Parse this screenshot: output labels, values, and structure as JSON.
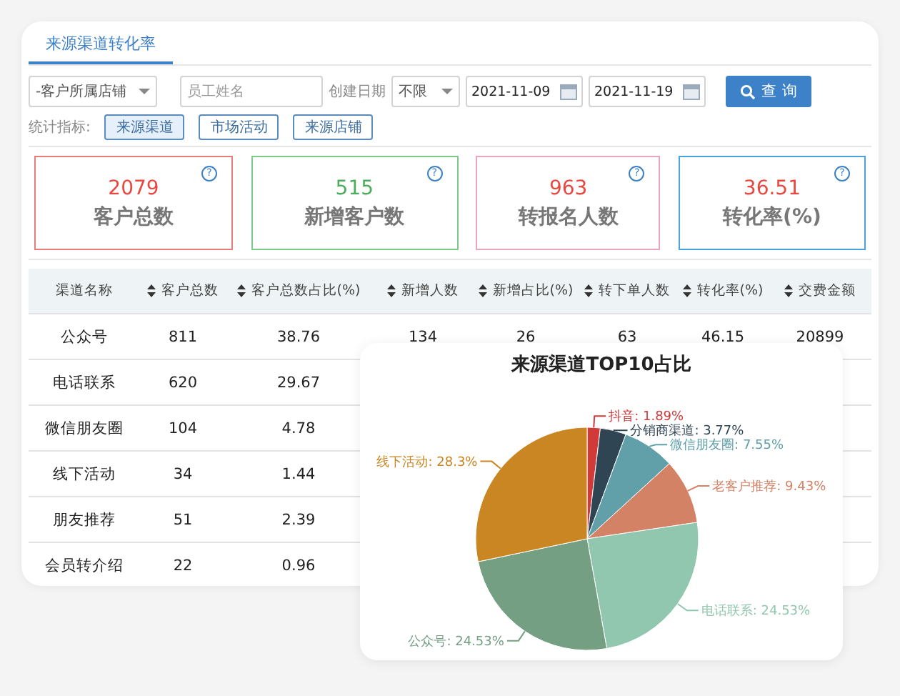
{
  "tabs": [
    {
      "label": "来源渠道转化率",
      "selected": true
    }
  ],
  "filters": {
    "store_select": "-客户所属店铺",
    "employee": {
      "placeholder": "员工姓名"
    },
    "date_label": "创建日期",
    "date_range_select": "不限",
    "start_date": "2021-11-09",
    "end_date": "2021-11-19",
    "query_button": "查 询"
  },
  "indicators": {
    "label": "统计指标:",
    "options": [
      {
        "label": "来源渠道",
        "selected": true
      },
      {
        "label": "市场活动",
        "selected": false
      },
      {
        "label": "来源店铺",
        "selected": false
      }
    ]
  },
  "stats": [
    {
      "value": {
        "text": "2079",
        "color": "#e8483f"
      },
      "label": "客户总数",
      "help": "?",
      "color": "#e87c7c"
    },
    {
      "value": {
        "text": "515",
        "color": "#4cae5c"
      },
      "label": "新增客户数",
      "help": "?",
      "color": "#7cc98a"
    },
    {
      "value": {
        "text": "963",
        "color": "#e8483f"
      },
      "label": "转报名人数",
      "help": "?",
      "color": "#e8a6bb"
    },
    {
      "value": {
        "text": "36.51",
        "color": "#e8483f"
      },
      "label": "转化率(%)",
      "help": "?",
      "color": "#4aa3df"
    }
  ],
  "table": {
    "columns": [
      {
        "label": "渠道名称",
        "sortable": false
      },
      {
        "label": "客户总数",
        "sortable": true
      },
      {
        "label": "客户总数占比(%)",
        "sortable": true
      },
      {
        "label": "新增人数",
        "sortable": true
      },
      {
        "label": "新增占比(%)",
        "sortable": true
      },
      {
        "label": "转下单人数",
        "sortable": true
      },
      {
        "label": "转化率(%)",
        "sortable": true
      },
      {
        "label": "交费金额",
        "sortable": true
      }
    ],
    "rows": [
      [
        "公众号",
        "811",
        "38.76",
        "134",
        "26",
        "63",
        "46.15",
        "20899"
      ],
      [
        "电话联系",
        "620",
        "29.67"
      ],
      [
        "微信朋友圈",
        "104",
        "4.78"
      ],
      [
        "线下活动",
        "34",
        "1.44"
      ],
      [
        "朋友推荐",
        "51",
        "2.39"
      ],
      [
        "会员转介绍",
        "22",
        "0.96"
      ]
    ]
  },
  "pie_panel": {
    "chart_data": {
      "type": "pie",
      "title": "来源渠道TOP10占比",
      "values": [
        1.89,
        3.77,
        7.55,
        9.43,
        24.53,
        24.53,
        28.3
      ],
      "colors": [
        "#d23a3a",
        "#2f4554",
        "#61a0a8",
        "#d48265",
        "#91c7ae",
        "#749f83",
        "#ca8622"
      ],
      "value_labels": [
        "抖音: 1.89%",
        "分销商渠道: 3.77%",
        "微信朋友圈: 7.55%",
        "老客户推荐: 9.43%",
        "电话联系: 24.53%",
        "公众号: 24.53%",
        "线下活动: 28.3%"
      ]
    }
  }
}
